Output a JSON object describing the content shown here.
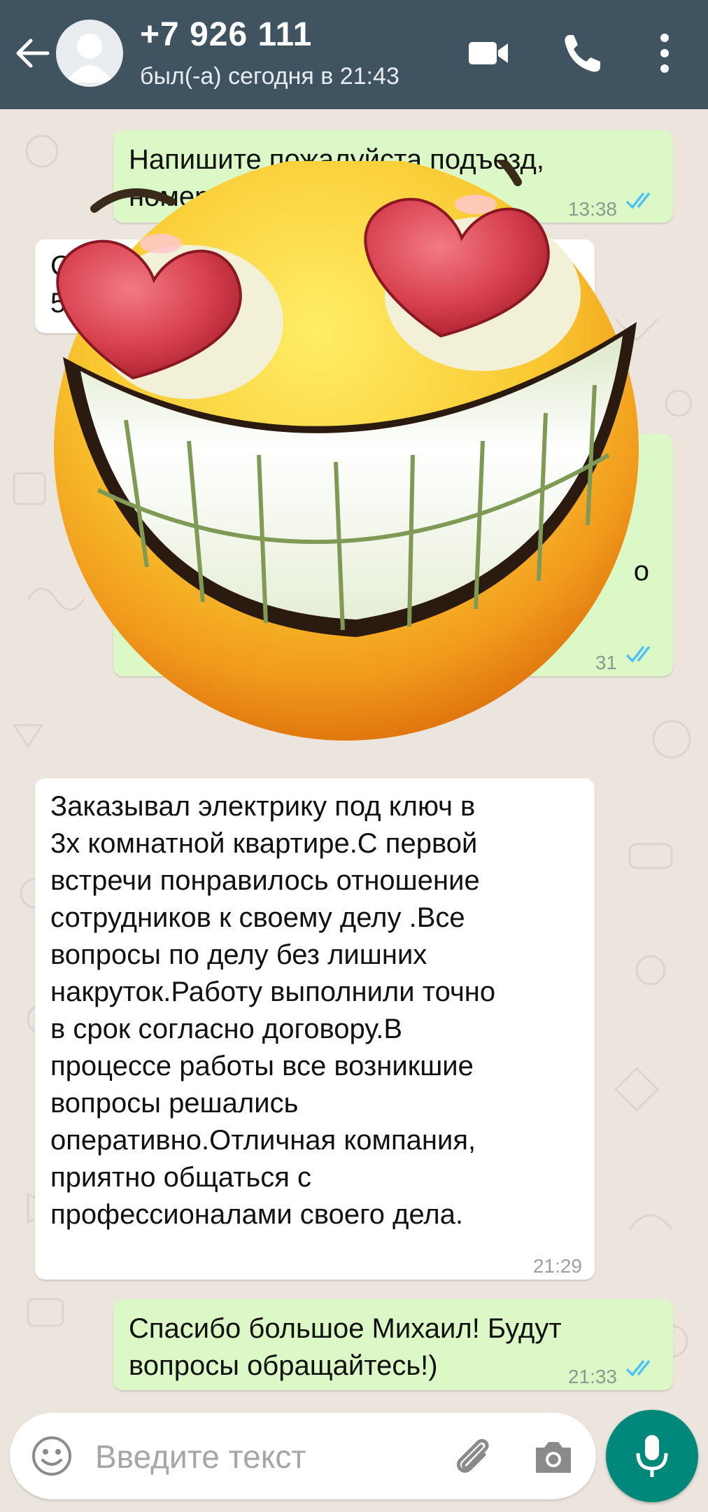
{
  "header": {
    "contact_name": "+7 926 111",
    "last_seen": "был(-а) сегодня в 21:43",
    "icons": [
      "back-arrow-icon",
      "avatar",
      "video-call-icon",
      "phone-icon",
      "more-vert-icon"
    ]
  },
  "messages": [
    {
      "direction": "out",
      "text": "Напишите пожалуйста подъезд,\nномер",
      "time": "13:38",
      "status": "read"
    },
    {
      "direction": "in",
      "text": "Саян\n522",
      "time": ""
    },
    {
      "direction": "out",
      "text": "о",
      "time": "31",
      "status": "read"
    },
    {
      "direction": "in",
      "text": "Заказывал электрику под ключ в\n3х комнатной квартире.С первой\nвстречи понравилось отношение\nсотрудников к своему делу .Все\nвопросы по делу без лишних\nнакруток.Работу выполнили точно\nв срок согласно договору.В\nпроцессе работы все возникшие\nвопросы решались\nоперативно.Отличная компания,\nприятно общаться с\nпрофессионалами своего дела.",
      "time": "21:29"
    },
    {
      "direction": "out",
      "text": "Спасибо большое Михаил! Будут\nвопросы обращайтесь!)",
      "time": "21:33",
      "status": "read"
    }
  ],
  "overlay": {
    "icon": "heart-eyes-smiley-icon"
  },
  "input": {
    "placeholder": "Введите текст",
    "value": ""
  },
  "colors": {
    "header": "#3F5360",
    "outgoing": "#DCF8C6",
    "incoming": "#FFFFFF",
    "accent": "#00897B",
    "read_ticks": "#4FC3F7"
  }
}
